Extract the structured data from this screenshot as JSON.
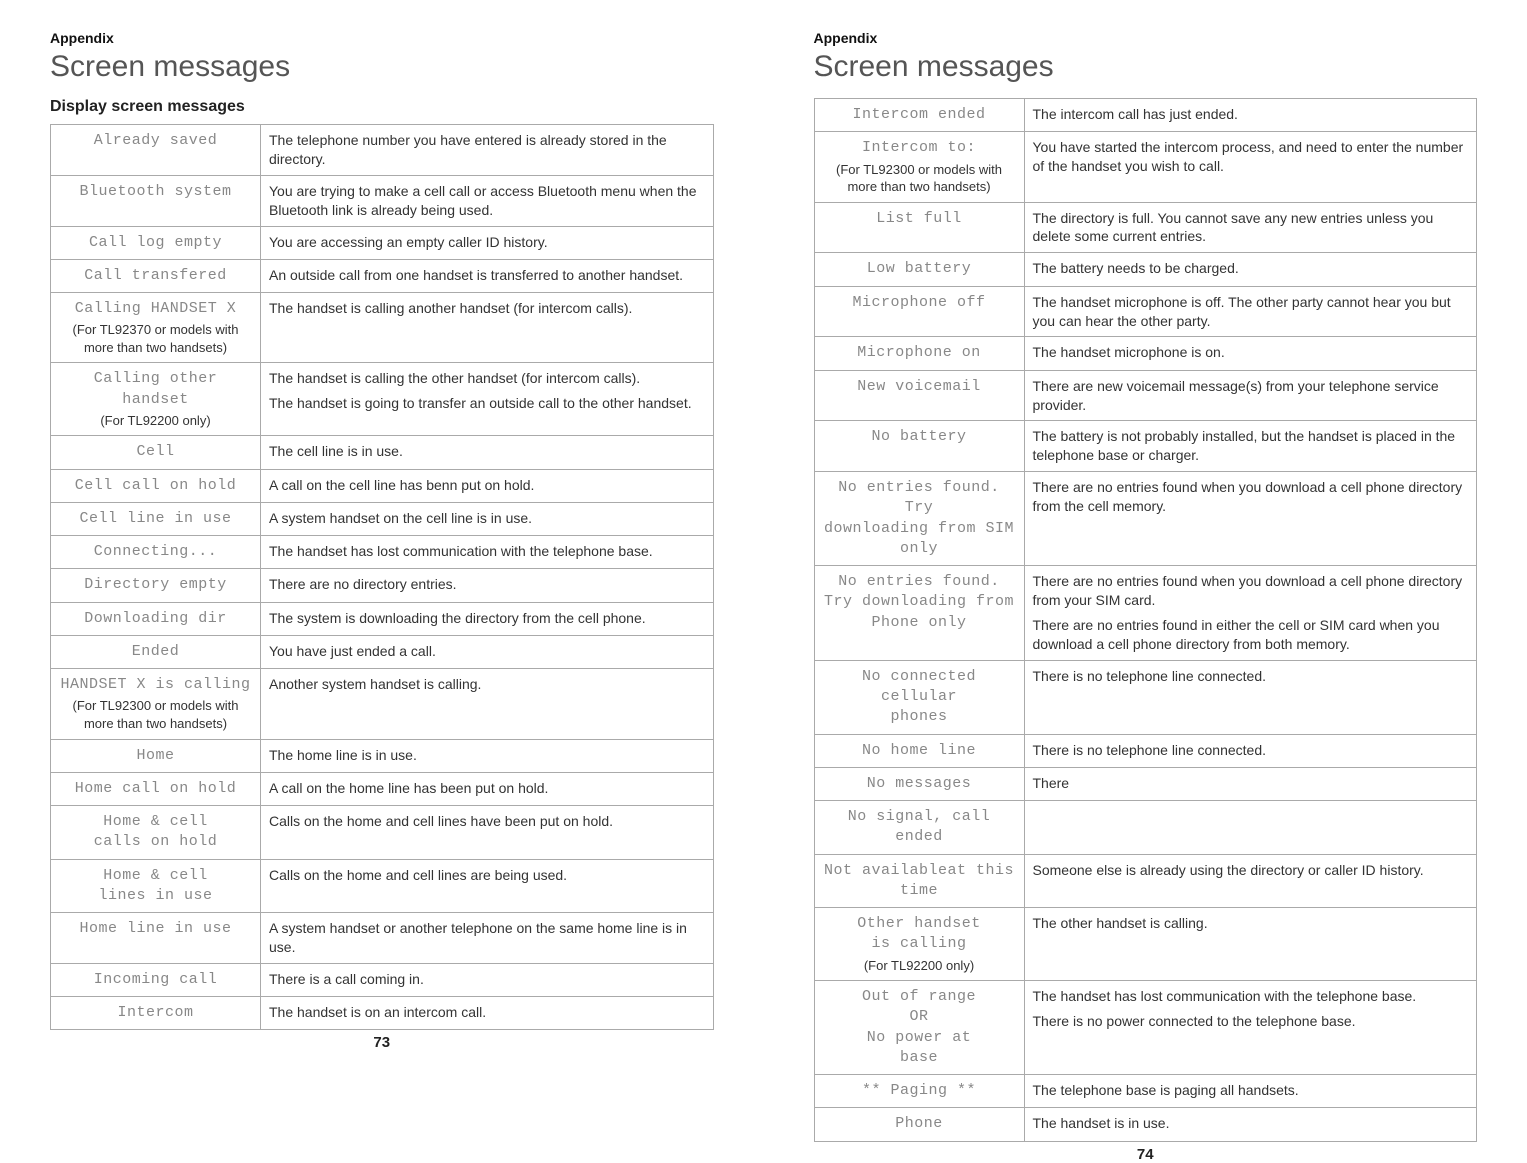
{
  "left": {
    "appendix": "Appendix",
    "title": "Screen messages",
    "subhead": "Display screen messages",
    "pagenum": "73",
    "rows": [
      {
        "lcd": [
          "Already saved"
        ],
        "note": "",
        "desc": [
          "The telephone number you have entered is already stored in the directory."
        ]
      },
      {
        "lcd": [
          "Bluetooth system"
        ],
        "note": "",
        "desc": [
          "You are trying to make a cell call or access Bluetooth menu when the Bluetooth link is already being used."
        ]
      },
      {
        "lcd": [
          "Call log empty"
        ],
        "note": "",
        "desc": [
          "You are accessing an empty caller ID history."
        ]
      },
      {
        "lcd": [
          "Call transfered"
        ],
        "note": "",
        "desc": [
          "An outside call from one handset is transferred to another handset."
        ]
      },
      {
        "lcd": [
          "Calling HANDSET X"
        ],
        "note": "(For TL92370 or models with more than two handsets)",
        "desc": [
          "The handset is calling another handset (for intercom calls)."
        ]
      },
      {
        "lcd": [
          "Calling other handset"
        ],
        "note": "(For TL92200 only)",
        "desc": [
          "The handset is calling the other handset (for intercom calls).",
          "The handset is going to transfer an outside call to the other handset."
        ]
      },
      {
        "lcd": [
          "Cell"
        ],
        "note": "",
        "desc": [
          "The cell line is in use."
        ]
      },
      {
        "lcd": [
          "Cell call on hold"
        ],
        "note": "",
        "desc": [
          "A call on the cell line has benn put on hold."
        ]
      },
      {
        "lcd": [
          "Cell line in use"
        ],
        "note": "",
        "desc": [
          "A system handset on the cell line is in use."
        ]
      },
      {
        "lcd": [
          "Connecting..."
        ],
        "note": "",
        "desc": [
          "The handset has lost communication with the telephone base."
        ]
      },
      {
        "lcd": [
          "Directory empty"
        ],
        "note": "",
        "desc": [
          "There are no directory entries."
        ]
      },
      {
        "lcd": [
          "Downloading dir"
        ],
        "note": "",
        "desc": [
          "The system is downloading the directory from the cell phone."
        ]
      },
      {
        "lcd": [
          "Ended"
        ],
        "note": "",
        "desc": [
          "You have just ended a call."
        ]
      },
      {
        "lcd": [
          "HANDSET X is calling"
        ],
        "note": "(For TL92300 or models with more than two handsets)",
        "desc": [
          "Another system handset is calling."
        ]
      },
      {
        "lcd": [
          "Home"
        ],
        "note": "",
        "desc": [
          "The home line is in use."
        ]
      },
      {
        "lcd": [
          "Home call on hold"
        ],
        "note": "",
        "desc": [
          "A call on the home line has been put on hold."
        ]
      },
      {
        "lcd": [
          "Home & cell",
          "calls on hold"
        ],
        "note": "",
        "desc": [
          "Calls on the home and cell lines have been put on hold."
        ]
      },
      {
        "lcd": [
          "Home & cell",
          "lines in use"
        ],
        "note": "",
        "desc": [
          "Calls on the home and cell lines are being used."
        ]
      },
      {
        "lcd": [
          "Home line in use"
        ],
        "note": "",
        "desc": [
          "A system handset or another telephone on the same home line is in use."
        ]
      },
      {
        "lcd": [
          "Incoming call"
        ],
        "note": "",
        "desc": [
          "There is a call coming in."
        ]
      },
      {
        "lcd": [
          "Intercom"
        ],
        "note": "",
        "desc": [
          "The handset is on an intercom call."
        ]
      }
    ]
  },
  "right": {
    "appendix": "Appendix",
    "title": "Screen messages",
    "pagenum": "74",
    "rows": [
      {
        "lcd": [
          "Intercom ended"
        ],
        "note": "",
        "desc": [
          "The intercom call has just ended."
        ]
      },
      {
        "lcd": [
          "Intercom to:"
        ],
        "note": "(For TL92300 or models with more than two handsets)",
        "desc": [
          "You have started the intercom process, and need to enter the number of the handset you wish to call."
        ]
      },
      {
        "lcd": [
          "List full"
        ],
        "note": "",
        "desc": [
          "The directory is full. You cannot save any new entries unless you delete some current entries."
        ]
      },
      {
        "lcd": [
          "Low battery"
        ],
        "note": "",
        "desc": [
          "The battery needs to be charged."
        ]
      },
      {
        "lcd": [
          "Microphone off"
        ],
        "note": "",
        "desc": [
          "The handset microphone is off. The other party cannot hear you but you can hear the other party."
        ]
      },
      {
        "lcd": [
          "Microphone on"
        ],
        "note": "",
        "desc": [
          "The handset microphone is on."
        ]
      },
      {
        "lcd": [
          "New voicemail"
        ],
        "note": "",
        "desc": [
          "There are new voicemail message(s) from your telephone service provider."
        ]
      },
      {
        "lcd": [
          "No battery"
        ],
        "note": "",
        "desc": [
          "The battery is not probably installed, but the handset is placed in the telephone base or charger."
        ]
      },
      {
        "lcd": [
          "No entries found. Try",
          "downloading from SIM",
          "only"
        ],
        "note": "",
        "desc": [
          "There are no entries found when you download a cell phone directory from the cell memory."
        ]
      },
      {
        "lcd": [
          "No entries found.",
          "Try downloading from",
          "Phone only"
        ],
        "note": "",
        "desc": [
          "There are no entries found when you download a cell phone directory from your SIM card.",
          "There are no entries found in either the cell or SIM card when you download a cell phone directory from both memory."
        ]
      },
      {
        "lcd": [
          "No connected cellular",
          "phones"
        ],
        "note": "",
        "desc": [
          "There is no telephone line connected."
        ]
      },
      {
        "lcd": [
          "No home line"
        ],
        "note": "",
        "desc": [
          "There is no telephone line connected."
        ]
      },
      {
        "lcd": [
          "No messages"
        ],
        "note": "",
        "desc": [
          "There"
        ]
      },
      {
        "lcd": [
          "No signal, call ended"
        ],
        "note": "",
        "desc": [
          ""
        ]
      },
      {
        "lcd": [
          "Not availableat this",
          "time"
        ],
        "note": "",
        "desc": [
          "Someone else is already using the directory or caller ID history."
        ]
      },
      {
        "lcd": [
          "Other handset",
          "is calling"
        ],
        "note": "(For TL92200 only)",
        "desc": [
          "The other handset is calling."
        ]
      },
      {
        "lcd": [
          "Out of range",
          "OR",
          "No power at",
          "base"
        ],
        "note": "",
        "desc": [
          "The handset has lost communication with the telephone base.",
          "There is no power connected to the telephone base."
        ]
      },
      {
        "lcd": [
          "** Paging **"
        ],
        "note": "",
        "desc": [
          "The telephone base is paging all handsets."
        ]
      },
      {
        "lcd": [
          "Phone"
        ],
        "note": "",
        "desc": [
          "The handset is in use."
        ]
      }
    ]
  }
}
